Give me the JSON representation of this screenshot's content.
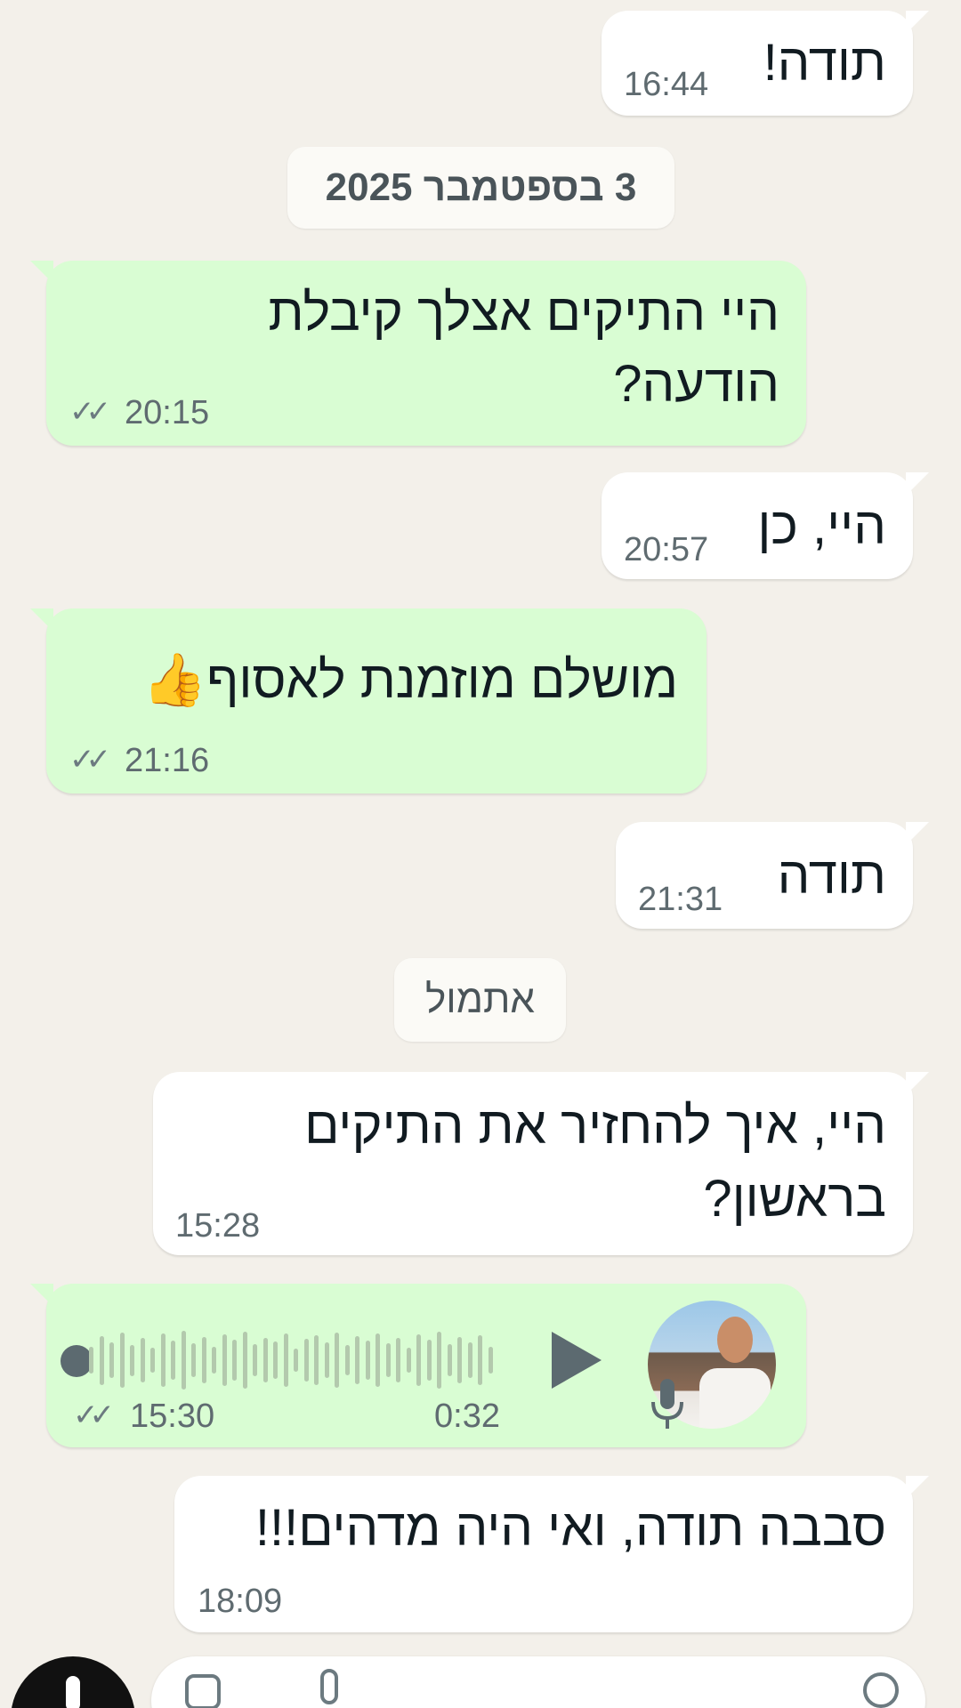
{
  "messages": [
    {
      "text": "תודה!",
      "time": "16:44",
      "direction": "incoming"
    },
    {
      "text_line1": "היי התיקים אצלך קיבלת",
      "text_line2": "הודעה?",
      "time": "20:15",
      "direction": "outgoing",
      "ticks": "✓✓"
    },
    {
      "text": "היי, כן",
      "time": "20:57",
      "direction": "incoming"
    },
    {
      "text": "מושלם מוזמנת לאסוף",
      "emoji": "👍",
      "time": "21:16",
      "direction": "outgoing",
      "ticks": "✓✓"
    },
    {
      "text": "תודה",
      "time": "21:31",
      "direction": "incoming"
    },
    {
      "text_line1": "היי, איך להחזיר את התיקים",
      "text_line2": "בראשון?",
      "time": "15:28",
      "direction": "incoming"
    },
    {
      "voice_duration": "0:32",
      "time": "15:30",
      "direction": "outgoing",
      "ticks": "✓✓"
    },
    {
      "text": "סבבה תודה, ואי היה מדהים!!!",
      "time": "18:09",
      "direction": "incoming"
    }
  ],
  "dates": {
    "date1": "3 בספטמבר 2025",
    "date2": "אתמול"
  },
  "colors": {
    "background": "#f3f0ea",
    "incoming_bubble": "#ffffff",
    "outgoing_bubble": "#d9fdd3"
  }
}
